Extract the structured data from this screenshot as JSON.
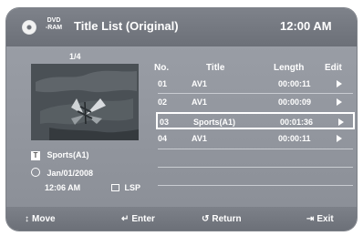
{
  "header": {
    "disc_icon": "disc-icon",
    "disc_label": "DVD\n-RAM",
    "title": "Title List (Original)",
    "time": "12:00 AM"
  },
  "preview": {
    "counter": "1/4",
    "title_icon_text": "T",
    "title": "Sports(A1)",
    "date": "Jan/01/2008",
    "time": "12:06 AM",
    "quality": "LSP"
  },
  "table": {
    "columns": [
      "No.",
      "Title",
      "Length",
      "Edit"
    ],
    "rows": [
      {
        "no": "01",
        "title": "AV1",
        "length": "00:00:11"
      },
      {
        "no": "02",
        "title": "AV1",
        "length": "00:00:09"
      },
      {
        "no": "03",
        "title": "Sports(A1)",
        "length": "00:01:36"
      },
      {
        "no": "04",
        "title": "AV1",
        "length": "00:00:11"
      }
    ]
  },
  "footer": {
    "move": "Move",
    "enter": "Enter",
    "return": "Return",
    "exit": "Exit"
  }
}
